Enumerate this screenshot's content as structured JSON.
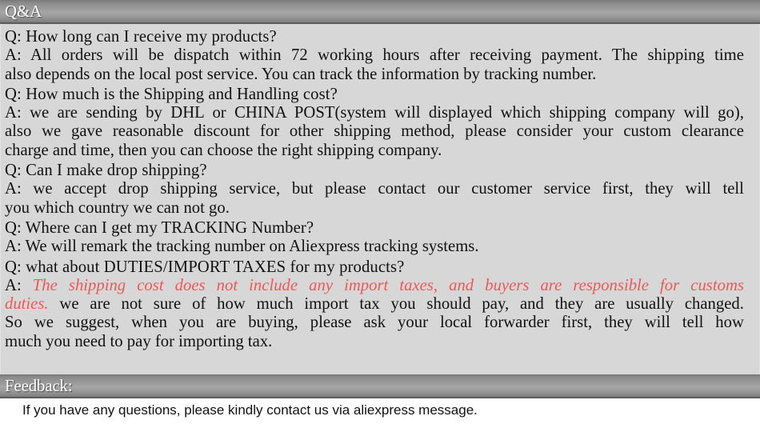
{
  "sections": {
    "qa": {
      "title": "Q&A",
      "blocks": [
        {
          "question": "Q: How long can I receive my products?",
          "answer_lines": [
            "A: All orders will be dispatch within 72 working hours after receiving payment. The shipping time",
            "also depends on the local post service. You can track the information by tracking number."
          ]
        },
        {
          "question": "Q: How much is the Shipping and Handling cost?",
          "answer_lines": [
            "A: we are sending by DHL or CHINA POST(system will displayed which shipping company will go),",
            "also we gave reasonable discount for other shipping method, please consider your custom clearance",
            "charge and time, then you can choose the right shipping company."
          ]
        },
        {
          "question": "Q: Can I make drop shipping?",
          "answer_lines": [
            "A: we accept drop shipping service, but please contact our customer service first, they will tell",
            "you which country we can not go."
          ]
        },
        {
          "question": "Q: Where can I get my TRACKING Number?",
          "answer_lines": [
            "A: We will remark the tracking number on Aliexpress tracking systems."
          ]
        },
        {
          "question": "Q: what about DUTIES/IMPORT TAXES for my products?",
          "answer_prefix": "A: ",
          "answer_highlight": "The shipping cost does not include any import taxes, and buyers are responsible for customs",
          "answer_highlight_tail": "duties.",
          "answer_lines": [
            " we are not sure of how much import tax you should pay, and they are usually changed.",
            "So we suggest, when you are buying, please ask your local forwarder first, they will tell how",
            "much you need to pay for importing tax."
          ]
        }
      ]
    },
    "feedback": {
      "title": "Feedback:",
      "text": "If you have any questions, please kindly contact us via aliexpress message."
    }
  },
  "colors": {
    "highlight_red": "#ee5757",
    "body_background": "#d7d7d7",
    "bar_text": "#ffffff"
  }
}
